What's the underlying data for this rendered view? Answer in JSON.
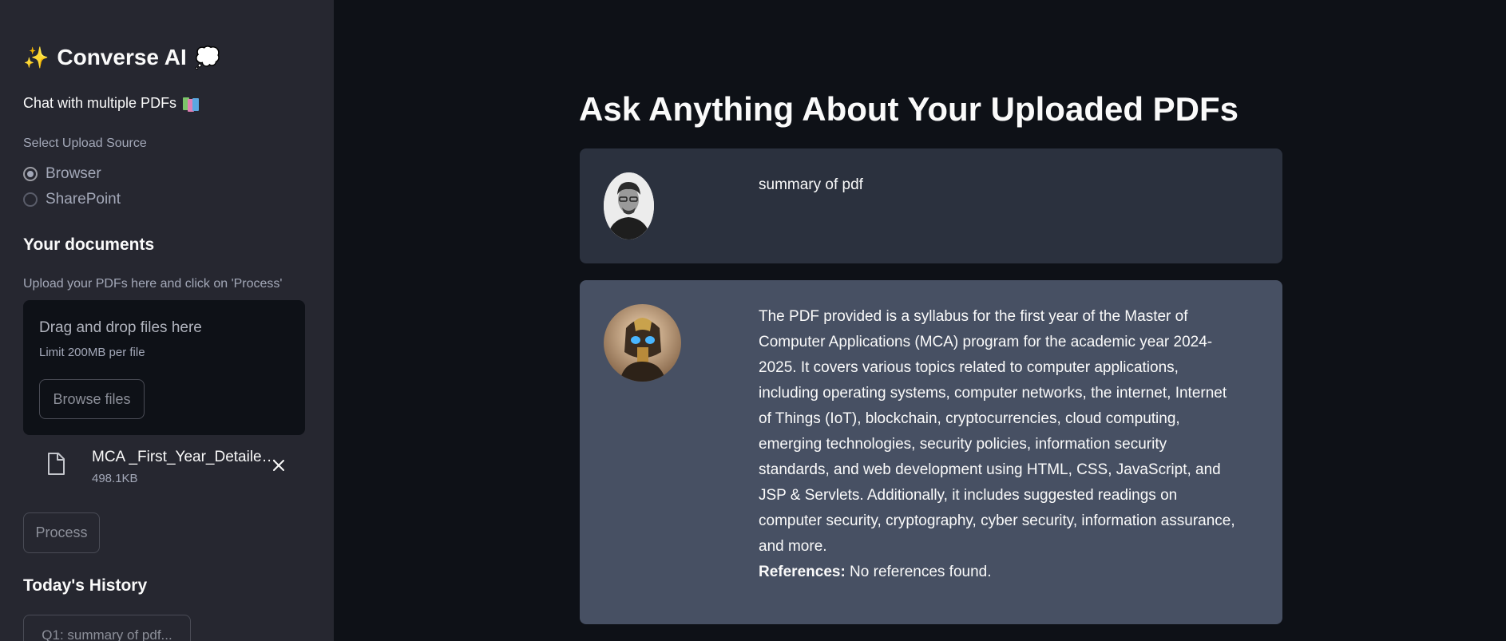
{
  "sidebar": {
    "title": "Converse AI",
    "title_emoji_left": "✨",
    "title_emoji_right": "💭",
    "subtitle": "Chat with multiple PDFs",
    "radio_group_label": "Select Upload Source",
    "radio_options": [
      {
        "label": "Browser",
        "checked": true
      },
      {
        "label": "SharePoint",
        "checked": false
      }
    ],
    "documents_heading": "Your documents",
    "upload_hint": "Upload your PDFs here and click on 'Process'",
    "dropzone": {
      "main_text": "Drag and drop files here",
      "limit_text": "Limit 200MB per file",
      "browse_label": "Browse files"
    },
    "uploaded_file": {
      "name": "MCA _First_Year_Detaile…",
      "size": "498.1KB"
    },
    "process_label": "Process",
    "history_heading": "Today's History",
    "history_items": [
      "Q1: summary of pdf..."
    ]
  },
  "main": {
    "title": "Ask Anything About Your Uploaded PDFs",
    "messages": [
      {
        "role": "user",
        "text": "summary of pdf"
      },
      {
        "role": "assistant",
        "text": "The PDF provided is a syllabus for the first year of the Master of Computer Applications (MCA) program for the academic year 2024-2025. It covers various topics related to computer applications, including operating systems, computer networks, the internet, Internet of Things (IoT), blockchain, cryptocurrencies, cloud computing, emerging technologies, security policies, information security standards, and web development using HTML, CSS, JavaScript, and JSP & Servlets. Additionally, it includes suggested readings on computer security, cryptography, cyber security, information assurance, and more.",
        "references_label": "References:",
        "references_text": " No references found."
      }
    ]
  },
  "colors": {
    "sidebar_bg": "#262730",
    "main_bg": "#0e1117",
    "user_msg_bg": "#2b313e",
    "bot_msg_bg": "#475063"
  }
}
